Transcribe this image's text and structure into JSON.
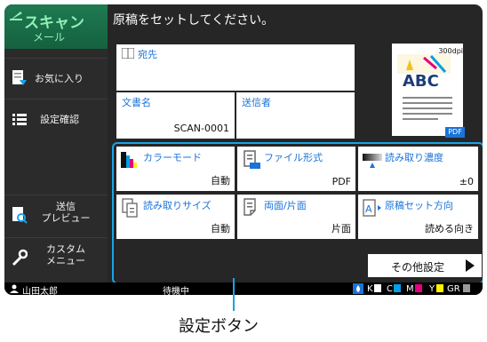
{
  "app": {
    "title": "スキャン",
    "subtitle": "メール"
  },
  "sidebar": {
    "items": [
      {
        "label": "お気に入り"
      },
      {
        "label": "設定確認"
      },
      {
        "label_line1": "送信",
        "label_line2": "プレビュー"
      },
      {
        "label_line1": "カスタム",
        "label_line2": "メニュー"
      }
    ]
  },
  "main": {
    "title": "原稿をセットしてください。",
    "destination_label": "宛先",
    "document_name_label": "文書名",
    "document_name_value": "SCAN-0001",
    "sender_label": "送信者"
  },
  "preview": {
    "dpi": "300dpi",
    "text": "ABC",
    "format_badge": "PDF"
  },
  "settings": {
    "buttons": [
      {
        "label": "カラーモード",
        "value": "自動",
        "icon": "color-mode-icon"
      },
      {
        "label": "ファイル形式",
        "value": "PDF",
        "icon": "file-format-icon"
      },
      {
        "label": "読み取り濃度",
        "value": "±0",
        "icon": "scan-density-icon"
      },
      {
        "label": "読み取りサイズ",
        "value": "自動",
        "icon": "scan-size-icon"
      },
      {
        "label": "両面/片面",
        "value": "片面",
        "icon": "duplex-icon"
      },
      {
        "label": "原稿セット方向",
        "value": "読める向き",
        "icon": "orientation-icon"
      }
    ],
    "other_label": "その他設定"
  },
  "status": {
    "user": "山田太郎",
    "state": "待機中",
    "toner": [
      {
        "label": "K",
        "color": "#ffffff"
      },
      {
        "label": "C",
        "color": "#00a0e9"
      },
      {
        "label": "M",
        "color": "#e4007f"
      },
      {
        "label": "Y",
        "color": "#fff100"
      },
      {
        "label": "GR",
        "color": "#9a9a9a"
      }
    ]
  },
  "callout": {
    "label": "設定ボタン"
  },
  "colors": {
    "accent": "#1a73d9",
    "highlight": "#1aa3e8",
    "app_green": "#1f7a52"
  }
}
